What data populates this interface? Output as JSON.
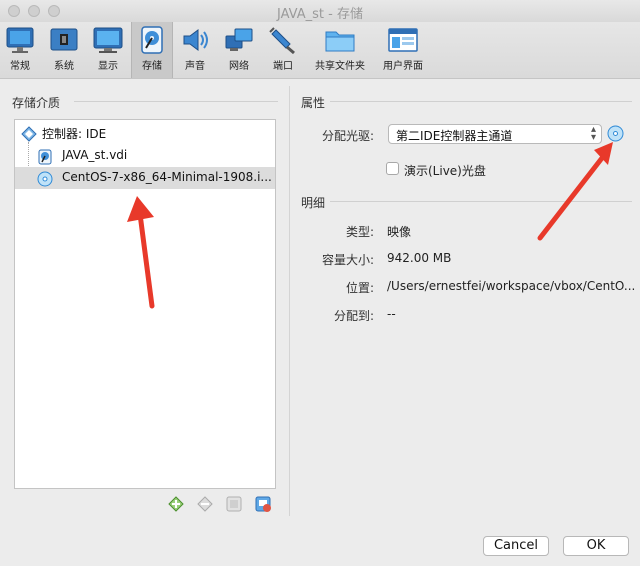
{
  "window": {
    "title": "JAVA_st - 存储"
  },
  "toolbar": {
    "items": [
      {
        "label": "常规",
        "icon": "monitor-icon"
      },
      {
        "label": "系统",
        "icon": "chip-icon"
      },
      {
        "label": "显示",
        "icon": "display-icon"
      },
      {
        "label": "存储",
        "icon": "hard-disk-icon"
      },
      {
        "label": "声音",
        "icon": "speaker-icon"
      },
      {
        "label": "网络",
        "icon": "network-icon"
      },
      {
        "label": "端口",
        "icon": "plug-icon"
      },
      {
        "label": "共享文件夹",
        "icon": "folder-icon"
      },
      {
        "label": "用户界面",
        "icon": "window-icon"
      }
    ],
    "active": "存储"
  },
  "storage": {
    "heading": "存储介质",
    "tree": [
      {
        "label": "控制器: IDE",
        "icon": "controller-icon"
      },
      {
        "label": "JAVA_st.vdi",
        "icon": "disk-image-icon"
      },
      {
        "label": "CentOS-7-x86_64-Minimal-1908.i...",
        "icon": "optical-disc-icon",
        "selected": true
      }
    ],
    "actions": [
      "add-attachment-icon",
      "remove-attachment-icon",
      "add-controller-icon",
      "remove-controller-icon"
    ]
  },
  "attributes": {
    "heading": "属性",
    "drive_label": "分配光驱:",
    "drive_value": "第二IDE控制器主通道",
    "live_cd_label": "演示(Live)光盘"
  },
  "details": {
    "heading": "明细",
    "rows": [
      {
        "label": "类型:",
        "value": "映像"
      },
      {
        "label": "容量大小:",
        "value": "942.00 MB"
      },
      {
        "label": "位置:",
        "value": "/Users/ernestfei/workspace/vbox/CentO..."
      },
      {
        "label": "分配到:",
        "value": "--"
      }
    ]
  },
  "buttons": {
    "cancel": "Cancel",
    "ok": "OK"
  },
  "colors": {
    "accent": "#1e88d8",
    "arrow": "#e8392a"
  }
}
